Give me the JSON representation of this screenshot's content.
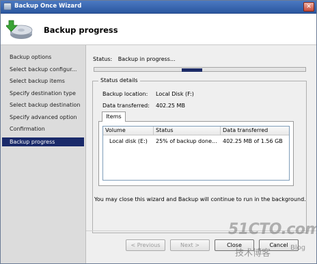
{
  "window": {
    "title": "Backup Once Wizard",
    "close_glyph": "✕"
  },
  "header": {
    "title": "Backup progress",
    "icon": "backup-disk-icon"
  },
  "sidebar": {
    "items": [
      {
        "label": "Backup options",
        "active": false
      },
      {
        "label": "Select backup configur...",
        "active": false
      },
      {
        "label": "Select backup items",
        "active": false
      },
      {
        "label": "Specify destination type",
        "active": false
      },
      {
        "label": "Select backup destination",
        "active": false
      },
      {
        "label": "Specify advanced option",
        "active": false
      },
      {
        "label": "Confirmation",
        "active": false
      },
      {
        "label": "Backup progress",
        "active": true
      }
    ]
  },
  "main": {
    "status_label": "Status:",
    "status_value": "Backup in progress...",
    "progress_fraction": 0.1,
    "details": {
      "title": "Status details",
      "location_label": "Backup location:",
      "location_value": "Local Disk (F:)",
      "transferred_label": "Data transferred:",
      "transferred_value": "402.25 MB"
    },
    "tab_label": "Items",
    "items_table": {
      "columns": [
        "Volume",
        "Status",
        "Data transferred"
      ],
      "rows": [
        [
          "Local disk (E:)",
          "25% of backup done...",
          "402.25 MB of 1.56 GB"
        ]
      ]
    },
    "note": "You may close this wizard and Backup will continue to run in the background."
  },
  "buttons": {
    "previous": "< Previous",
    "next": "Next >",
    "close": "Close",
    "cancel": "Cancel"
  },
  "watermark": {
    "site": "51CTO.com",
    "subtitle": "技术博客",
    "blog": "Blog"
  },
  "colors": {
    "title_bar": "#2b579f",
    "active_nav": "#1a2a6a",
    "progress_fill": "#1d2b67",
    "watermark": "#9a9a9a"
  }
}
